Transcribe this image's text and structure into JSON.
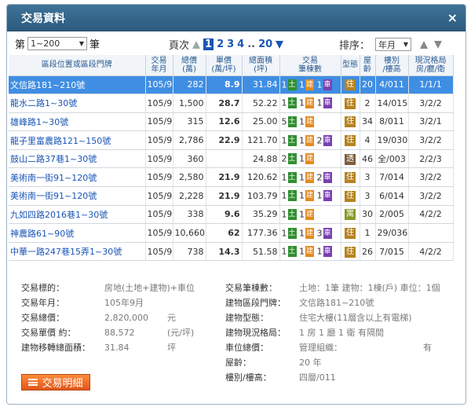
{
  "window": {
    "title": "交易資料",
    "close": "×"
  },
  "toolbar": {
    "page_prefix": "第",
    "range_value": "1~200",
    "page_suffix": "筆",
    "pages_label": "頁次",
    "pages": [
      "1",
      "2",
      "3",
      "4",
      "..",
      "20"
    ],
    "sort_label": "排序：",
    "sort_value": "年月"
  },
  "table": {
    "headers": [
      "區段位置或區段門牌",
      "交易\n年月",
      "總價\n(萬)",
      "單價\n(萬/坪)",
      "總面積\n(坪)",
      "交易\n筆棟數",
      "型態",
      "屋\n齡",
      "樓別\n/樓高",
      "現況格局\n房/廳/衛"
    ],
    "rows": [
      {
        "addr": "文信路181~210號",
        "ym": "105/9",
        "total": "282",
        "unit": "8.9",
        "area": "31.84",
        "land": "1",
        "bldg": "1",
        "park": "1",
        "type": "住",
        "age": "20",
        "floor": "4/011",
        "layout": "1/1/1"
      },
      {
        "addr": "龍水二路1~30號",
        "ym": "105/9",
        "total": "1,500",
        "unit": "28.7",
        "area": "52.22",
        "land": "1",
        "bldg": "1",
        "park": "1",
        "type": "住",
        "age": "2",
        "floor": "14/015",
        "layout": "3/2/2"
      },
      {
        "addr": "雄峰路1~30號",
        "ym": "105/9",
        "total": "315",
        "unit": "12.6",
        "area": "25.00",
        "land": "5",
        "bldg": "1",
        "park": "",
        "type": "住",
        "age": "34",
        "floor": "8/011",
        "layout": "3/2/1"
      },
      {
        "addr": "龍子里富農路121~150號",
        "ym": "105/9",
        "total": "2,786",
        "unit": "22.9",
        "area": "121.70",
        "land": "1",
        "bldg": "1",
        "park": "2",
        "type": "住",
        "age": "4",
        "floor": "19/030",
        "layout": "3/2/2"
      },
      {
        "addr": "鼓山二路37巷1~30號",
        "ym": "105/9",
        "total": "360",
        "unit": "",
        "area": "24.88",
        "land": "2",
        "bldg": "1",
        "park": "",
        "type": "透",
        "age": "46",
        "floor": "全/003",
        "layout": "2/2/3"
      },
      {
        "addr": "美術南一街91~120號",
        "ym": "105/9",
        "total": "2,580",
        "unit": "21.9",
        "area": "120.62",
        "land": "1",
        "bldg": "1",
        "park": "2",
        "type": "住",
        "age": "3",
        "floor": "7/014",
        "layout": "3/2/2"
      },
      {
        "addr": "美術南一街91~120號",
        "ym": "105/9",
        "total": "2,228",
        "unit": "21.9",
        "area": "103.79",
        "land": "1",
        "bldg": "1",
        "park": "1",
        "type": "住",
        "age": "3",
        "floor": "6/014",
        "layout": "3/2/2"
      },
      {
        "addr": "九如四路2016巷1~30號",
        "ym": "105/9",
        "total": "338",
        "unit": "9.6",
        "area": "35.29",
        "land": "1",
        "bldg": "1",
        "park": "",
        "type": "寓",
        "age": "30",
        "floor": "2/005",
        "layout": "4/2/2"
      },
      {
        "addr": "神農路61~90號",
        "ym": "105/9",
        "total": "10,660",
        "unit": "62",
        "area": "177.36",
        "land": "1",
        "bldg": "1",
        "park": "3",
        "type": "住",
        "age": "1",
        "floor": "29/036",
        "layout": ""
      },
      {
        "addr": "中華一路247巷15弄1~30號",
        "ym": "105/9",
        "total": "738",
        "unit": "14.3",
        "area": "51.58",
        "land": "1",
        "bldg": "1",
        "park": "1",
        "type": "住",
        "age": "26",
        "floor": "7/015",
        "layout": "4/2/2"
      }
    ],
    "badge_land": "土",
    "badge_bldg": "建",
    "badge_park": "車"
  },
  "details": {
    "left": [
      {
        "k": "交易標的：",
        "v": "房地(土地+建物)+車位",
        "u": ""
      },
      {
        "k": "交易年月：",
        "v": "105年9月",
        "u": ""
      },
      {
        "k": "交易總價：",
        "v": "2,820,000",
        "u": "元"
      },
      {
        "k": "交易單價 約：",
        "v": "88,572",
        "u": "(元/坪)"
      },
      {
        "k": "建物移轉總面積：",
        "v": "31.84",
        "u": "坪"
      }
    ],
    "right": [
      {
        "k": "交易筆棟數：",
        "v": "土地：1筆 建物：1棟(戶) 車位：1個"
      },
      {
        "k": "建物區段門牌：",
        "v": "文信路181~210號"
      },
      {
        "k": "建物型態：",
        "v": "住宅大樓(11層含以上有電梯)"
      },
      {
        "k": "建物現況格局：",
        "v": "1 房 1 廳 1 衛 有隔間"
      },
      {
        "k": "車位總價：",
        "v": "管理組織：",
        "v2": "有"
      },
      {
        "k": "屋齡：",
        "v": "20 年"
      },
      {
        "k": "樓別/樓高：",
        "v": "四層/011"
      }
    ],
    "detail_button": "交易明細"
  }
}
